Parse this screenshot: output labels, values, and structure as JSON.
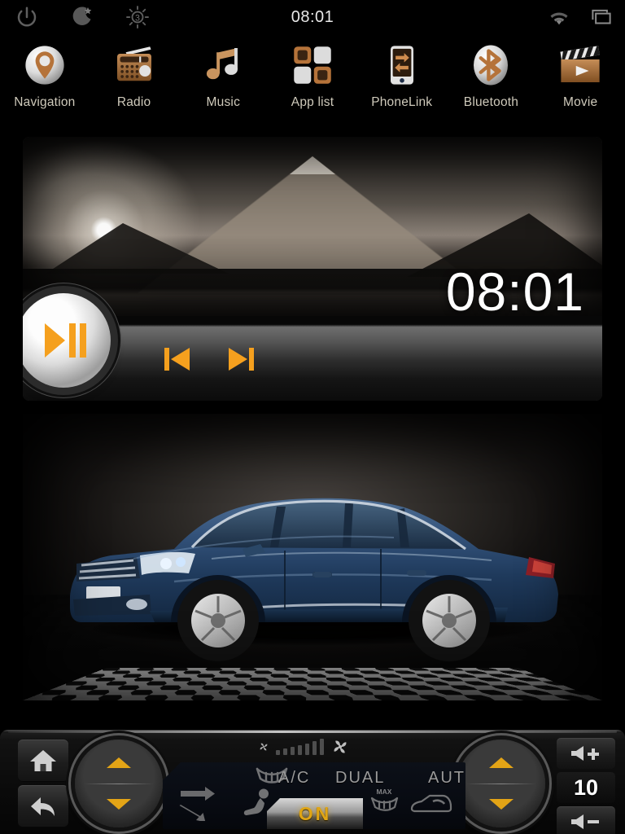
{
  "status_bar": {
    "clock": "08:01",
    "left_icons": [
      {
        "name": "power-icon",
        "label": "Power"
      },
      {
        "name": "night-mode-icon",
        "label": "Night mode"
      },
      {
        "name": "brightness-icon",
        "label": "Brightness",
        "value": "3"
      }
    ],
    "right_icons": [
      {
        "name": "wifi-icon",
        "label": "Wi-Fi"
      },
      {
        "name": "screen-icon",
        "label": "Screen"
      }
    ]
  },
  "dock": {
    "apps": [
      {
        "label": "Navigation",
        "icon": "map-pin-icon"
      },
      {
        "label": "Radio",
        "icon": "radio-icon"
      },
      {
        "label": "Music",
        "icon": "music-note-icon"
      },
      {
        "label": "App list",
        "icon": "grid-apps-icon"
      },
      {
        "label": "PhoneLink",
        "icon": "phone-link-icon"
      },
      {
        "label": "Bluetooth",
        "icon": "bluetooth-icon"
      },
      {
        "label": "Movie",
        "icon": "clapperboard-icon"
      }
    ]
  },
  "media_widget": {
    "clock_overlay": "08:01",
    "controls": {
      "play_pause": "play-pause-icon",
      "previous": "previous-track-icon",
      "next": "next-track-icon"
    }
  },
  "car_panel": {
    "vehicle": "sedan-illustration",
    "color": "#25405f"
  },
  "climate_bar": {
    "home_button": "home-icon",
    "back_button": "back-arrow-icon",
    "temp_left": {
      "name": "driver-temperature-knob",
      "up": "up-arrow-icon",
      "down": "down-arrow-icon"
    },
    "temp_right": {
      "name": "passenger-temperature-knob",
      "up": "up-arrow-icon",
      "down": "down-arrow-icon"
    },
    "fan": {
      "low_icon": "fan-small-icon",
      "high_icon": "fan-large-icon",
      "bars": 7,
      "active_bars": 7
    },
    "labels": {
      "ac": "A/C",
      "dual": "DUAL",
      "auto": "AUTO",
      "on": "ON",
      "max": "MAX"
    },
    "icons": {
      "airflow": "airflow-arrows-icon",
      "defrost": "front-defrost-icon",
      "seat": "seat-airflow-icon",
      "max_defrost": "max-defrost-icon",
      "rear_defog": "rear-defog-icon"
    },
    "volume": {
      "up": "volume-up-icon",
      "down": "volume-down-icon",
      "value": "10"
    }
  },
  "colors": {
    "accent_orange": "#f5a01e",
    "amber": "#e0a514",
    "label_text": "#cfcabb",
    "copper": "#b5733a"
  }
}
